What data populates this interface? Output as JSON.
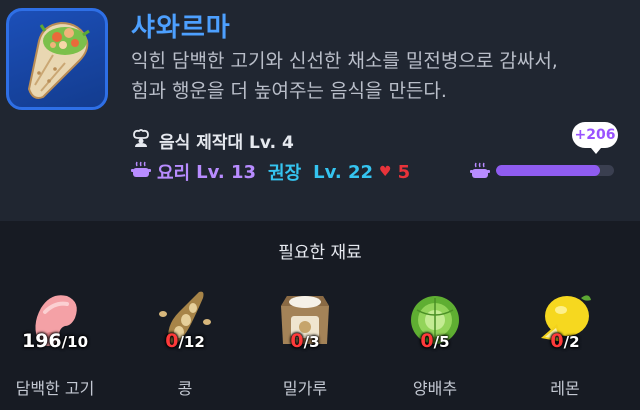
{
  "item": {
    "name": "샤와르마",
    "description_lines": [
      "익힌 담백한 고기와 신선한 채소를 밀전병으로 감싸서,",
      "힘과 행운을 더 높여주는 음식을 만든다."
    ],
    "icon": "shawarma-wrap-icon"
  },
  "station": {
    "label": "음식 제작대 Lv. 4",
    "icon": "chef-icon"
  },
  "levels": {
    "cooking_label": "요리",
    "cooking_value": "Lv. 13",
    "recommended_label": "권장",
    "recommended_value": "Lv. 22",
    "deficit": "5",
    "icon": "cooking-pot-icon"
  },
  "xp": {
    "gain": "+206",
    "current_fraction": 0.88,
    "icon": "cooking-pot-icon"
  },
  "materials_title": "필요한 재료",
  "materials": [
    {
      "name": "담백한 고기",
      "have": "196",
      "need": "/10",
      "enough": true,
      "icon": "meat-icon"
    },
    {
      "name": "콩",
      "have": "0",
      "need": "/12",
      "enough": false,
      "icon": "bean-pod-icon"
    },
    {
      "name": "밀가루",
      "have": "0",
      "need": "/3",
      "enough": false,
      "icon": "flour-sack-icon"
    },
    {
      "name": "양배추",
      "have": "0",
      "need": "/5",
      "enough": false,
      "icon": "cabbage-icon"
    },
    {
      "name": "레몬",
      "have": "0",
      "need": "/2",
      "enough": false,
      "icon": "lemon-icon"
    }
  ],
  "colors": {
    "title": "#4da0ff",
    "cooking": "#b88cff",
    "recommended": "#35c4f0",
    "warning": "#e8333a",
    "xp_bar": "#8f5cf0"
  }
}
